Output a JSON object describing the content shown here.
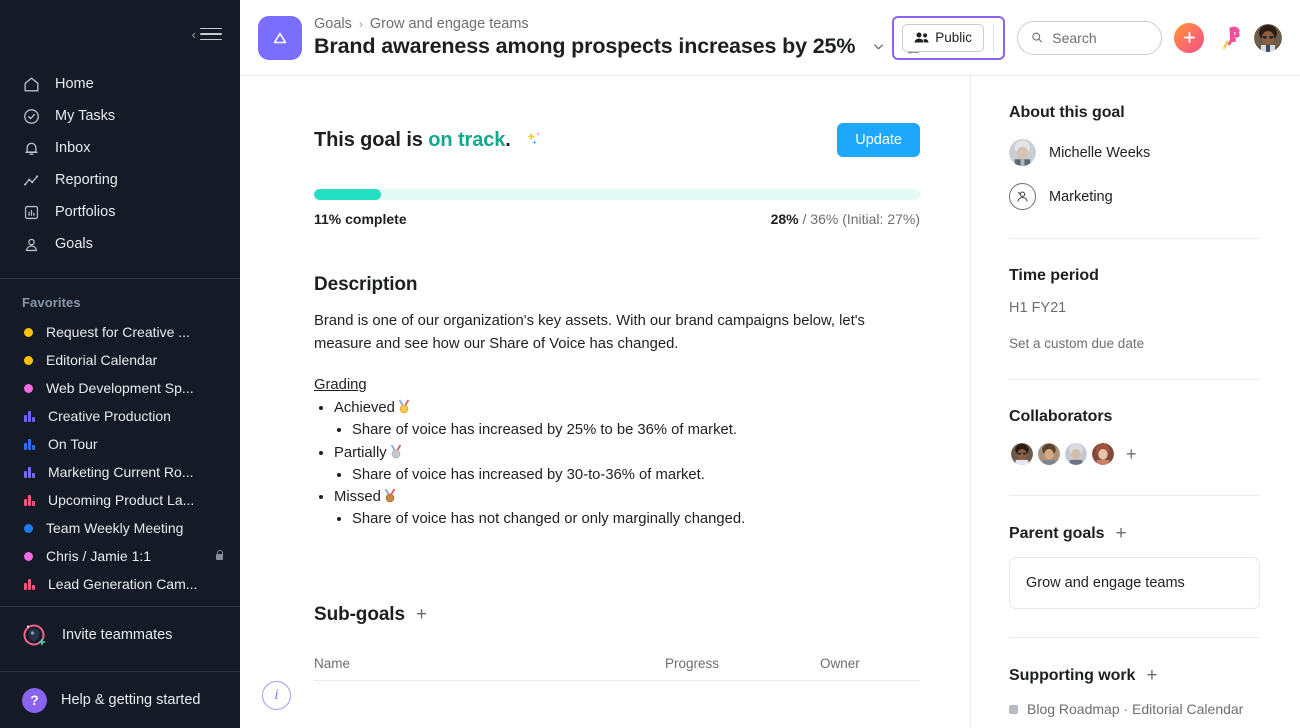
{
  "sidebar": {
    "nav": [
      {
        "label": "Home",
        "icon": "home-icon"
      },
      {
        "label": "My Tasks",
        "icon": "check-circle-icon"
      },
      {
        "label": "Inbox",
        "icon": "bell-icon"
      },
      {
        "label": "Reporting",
        "icon": "line-chart-icon"
      },
      {
        "label": "Portfolios",
        "icon": "portfolio-icon"
      },
      {
        "label": "Goals",
        "icon": "goals-person-icon"
      }
    ],
    "favorites_header": "Favorites",
    "favorites": [
      {
        "label": "Request for Creative ...",
        "type": "dot",
        "color": "#FFC107",
        "locked": false
      },
      {
        "label": "Editorial Calendar",
        "type": "dot",
        "color": "#FFC107",
        "locked": false
      },
      {
        "label": "Web Development Sp...",
        "type": "dot",
        "color": "#F06AE0",
        "locked": false
      },
      {
        "label": "Creative Production",
        "type": "bars",
        "color": "#6E63F5",
        "locked": false
      },
      {
        "label": "On Tour",
        "type": "bars",
        "color": "#2C6EF2",
        "locked": false
      },
      {
        "label": "Marketing Current Ro...",
        "type": "bars",
        "color": "#7A6BF0",
        "locked": false
      },
      {
        "label": "Upcoming Product La...",
        "type": "bars",
        "color": "#F4557C",
        "locked": false
      },
      {
        "label": "Team Weekly Meeting",
        "type": "dot",
        "color": "#1F7AF5",
        "locked": false
      },
      {
        "label": "Chris / Jamie 1:1",
        "type": "dot",
        "color": "#F06AE0",
        "locked": true
      },
      {
        "label": "Lead Generation Cam...",
        "type": "bars",
        "color": "#F4557C",
        "locked": false
      }
    ],
    "invite_label": "Invite teammates",
    "help_label": "Help & getting started",
    "help_glyph": "?"
  },
  "header": {
    "goal_icon": "triangle-goal-icon",
    "breadcrumb": {
      "root": "Goals",
      "separator": "›",
      "current": "Grow and engage teams"
    },
    "title": "Brand awareness among prospects increases by 25%",
    "caret_icon": "chevron-down-icon",
    "thumbs_icon": "thumbs-up-icon",
    "privacy": {
      "label": "Public",
      "icon": "people-icon"
    },
    "search": {
      "placeholder": "Search",
      "value": "",
      "icon": "search-icon"
    },
    "add_button": {
      "label": "+",
      "icon": "plus-icon"
    },
    "bird_icon": "bird-mascot-icon",
    "user_avatar": "user-avatar"
  },
  "goal": {
    "status_prefix": "This goal is ",
    "status_value": "on track",
    "status_suffix": ".",
    "sparkle_icon": "sparkles-icon",
    "update_label": "Update",
    "progress_percent": 11,
    "progress_label": "11% complete",
    "metric_current": "28%",
    "metric_rest": " / 36% (Initial: 27%)"
  },
  "description": {
    "heading": "Description",
    "paragraph": "Brand is one of our organization's key assets. With our brand campaigns below, let's measure and see how our Share of Voice has changed.",
    "grading_heading": "Grading",
    "grading": [
      {
        "label": "Achieved",
        "medal": "gold-medal-icon",
        "detail": "Share of voice has increased by 25% to be 36% of market."
      },
      {
        "label": "Partially",
        "medal": "silver-medal-icon",
        "detail": "Share of voice has increased by 30-to-36% of market."
      },
      {
        "label": "Missed",
        "medal": "bronze-medal-icon",
        "detail": "Share of voice has not changed or only marginally changed."
      }
    ]
  },
  "subgoals": {
    "heading": "Sub-goals",
    "add_icon": "plus-icon",
    "columns": {
      "name": "Name",
      "progress": "Progress",
      "owner": "Owner"
    },
    "rows": []
  },
  "info_fab": {
    "glyph": "i",
    "icon": "info-circle-icon"
  },
  "right_panel": {
    "about_heading": "About this goal",
    "owner": "Michelle Weeks",
    "team": "Marketing",
    "time_period_heading": "Time period",
    "time_period_value": "H1 FY21",
    "custom_due_date_link": "Set a custom due date",
    "collaborators_heading": "Collaborators",
    "collaborators_count": 4,
    "add_collaborator_icon": "plus-icon",
    "parent_goals_heading": "Parent goals",
    "parent_goal": "Grow and engage teams",
    "supporting_work_heading": "Supporting work",
    "supporting_item": "Blog Roadmap · Editorial Calendar"
  },
  "colors": {
    "sidebar_bg": "#151B26",
    "accent_purple": "#796EFF",
    "update_blue": "#1EA7FD",
    "on_track_green": "#14A88D",
    "progress_fill": "#25DFC3",
    "progress_track": "#E4FAF5"
  }
}
